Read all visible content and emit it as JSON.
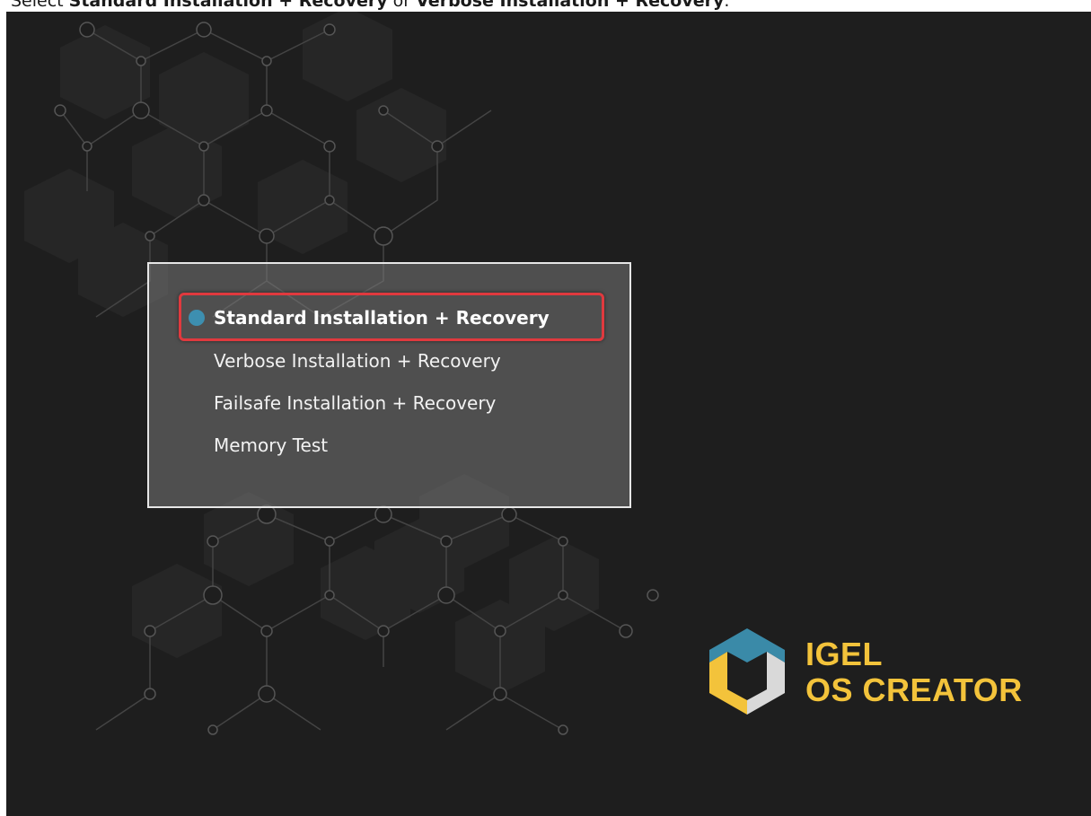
{
  "caption": {
    "prefix": "Select ",
    "option1": "Standard Installation + Recovery",
    "middle": " or ",
    "option2": "Verbose Installation + Recovery",
    "suffix": "."
  },
  "boot_menu": {
    "items": [
      {
        "label": "Standard Installation + Recovery",
        "selected": true
      },
      {
        "label": "Verbose Installation + Recovery",
        "selected": false
      },
      {
        "label": "Failsafe Installation + Recovery",
        "selected": false
      },
      {
        "label": "Memory Test",
        "selected": false
      }
    ]
  },
  "logo": {
    "line1": "IGEL",
    "line2": "OS CREATOR",
    "icon": "igel-logo-icon"
  },
  "colors": {
    "background": "#1e1e1e",
    "accent_yellow": "#f3c33b",
    "accent_blue": "#3d8fb0",
    "highlight_red": "#e0393e"
  }
}
